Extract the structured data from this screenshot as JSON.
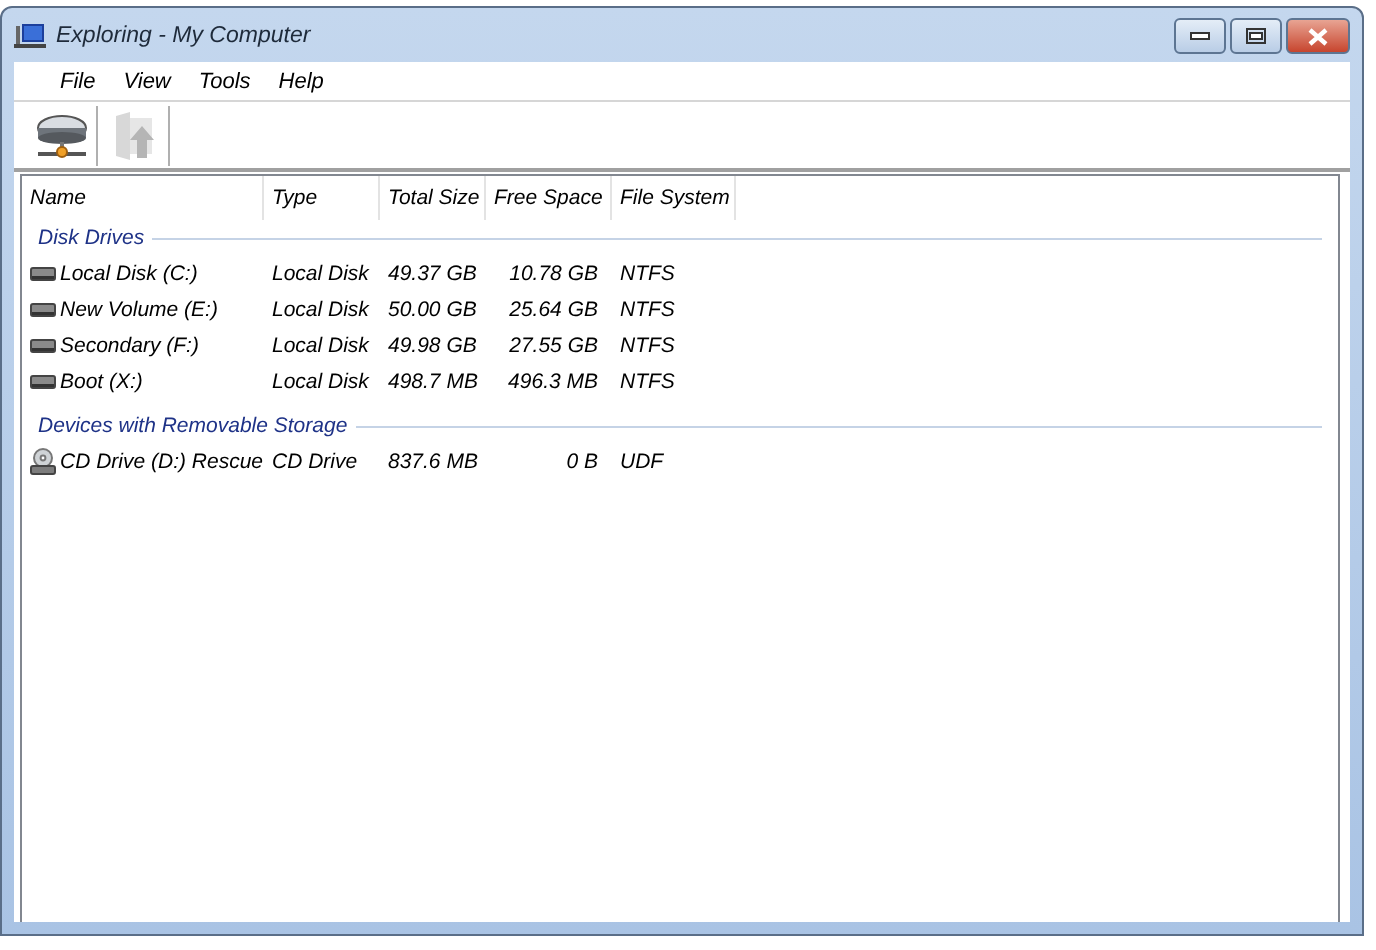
{
  "window": {
    "title": "Exploring - My Computer"
  },
  "menu": [
    "File",
    "View",
    "Tools",
    "Help"
  ],
  "toolbar": [
    {
      "kind": "drives",
      "disabled": false
    },
    {
      "kind": "up",
      "disabled": true
    }
  ],
  "columns": [
    "Name",
    "Type",
    "Total Size",
    "Free Space",
    "File System"
  ],
  "groups": [
    {
      "title": "Disk Drives",
      "rows": [
        {
          "kind": "disk",
          "cells": [
            "Local Disk (C:)",
            "Local Disk",
            "49.37 GB",
            "10.78 GB",
            "NTFS"
          ]
        },
        {
          "kind": "disk",
          "cells": [
            "New Volume (E:)",
            "Local Disk",
            "50.00 GB",
            "25.64 GB",
            "NTFS"
          ]
        },
        {
          "kind": "disk",
          "cells": [
            "Secondary (F:)",
            "Local Disk",
            "49.98 GB",
            "27.55 GB",
            "NTFS"
          ]
        },
        {
          "kind": "disk",
          "cells": [
            "Boot (X:)",
            "Local Disk",
            "498.7 MB",
            "496.3 MB",
            "NTFS"
          ]
        }
      ]
    },
    {
      "title": "Devices with Removable Storage",
      "rows": [
        {
          "kind": "cd",
          "cells": [
            "CD Drive (D:) Rescue",
            "CD Drive",
            "837.6 MB",
            "0 B",
            "UDF"
          ]
        }
      ]
    }
  ]
}
